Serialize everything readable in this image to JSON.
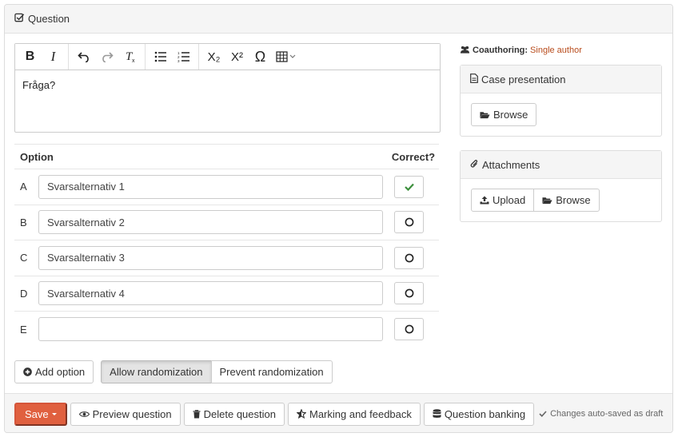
{
  "panel": {
    "title": "Question"
  },
  "toolbar": {
    "buttons": [
      "bold-icon",
      "italic-icon",
      "undo-icon",
      "redo-icon",
      "clear-format-icon",
      "bullet-list-icon",
      "numbered-list-icon",
      "subscript-icon",
      "superscript-icon",
      "omega-icon",
      "table-icon"
    ],
    "bold": "B",
    "italic": "I",
    "subscript": "X₂",
    "superscript": "X²",
    "omega": "Ω"
  },
  "editor": {
    "content": "Fråga?"
  },
  "options": {
    "header_option": "Option",
    "header_correct": "Correct?",
    "rows": [
      {
        "letter": "A",
        "value": "Svarsalternativ 1",
        "correct": true
      },
      {
        "letter": "B",
        "value": "Svarsalternativ 2",
        "correct": false
      },
      {
        "letter": "C",
        "value": "Svarsalternativ 3",
        "correct": false
      },
      {
        "letter": "D",
        "value": "Svarsalternativ 4",
        "correct": false
      },
      {
        "letter": "E",
        "value": "",
        "correct": false
      }
    ]
  },
  "actions": {
    "add_option": "Add option",
    "allow_randomization": "Allow randomization",
    "prevent_randomization": "Prevent randomization"
  },
  "side": {
    "coauthoring_label": "Coauthoring:",
    "coauthoring_value": "Single author",
    "case_title": "Case presentation",
    "case_browse": "Browse",
    "attach_title": "Attachments",
    "attach_upload": "Upload",
    "attach_browse": "Browse"
  },
  "footer": {
    "save": "Save",
    "preview": "Preview question",
    "delete": "Delete question",
    "marking": "Marking and feedback",
    "banking": "Question banking",
    "saved_status": "Changes auto-saved as draft"
  },
  "colors": {
    "save": "#e0603f",
    "check": "#3c8f3c",
    "coauth_value": "#b84c1c"
  }
}
